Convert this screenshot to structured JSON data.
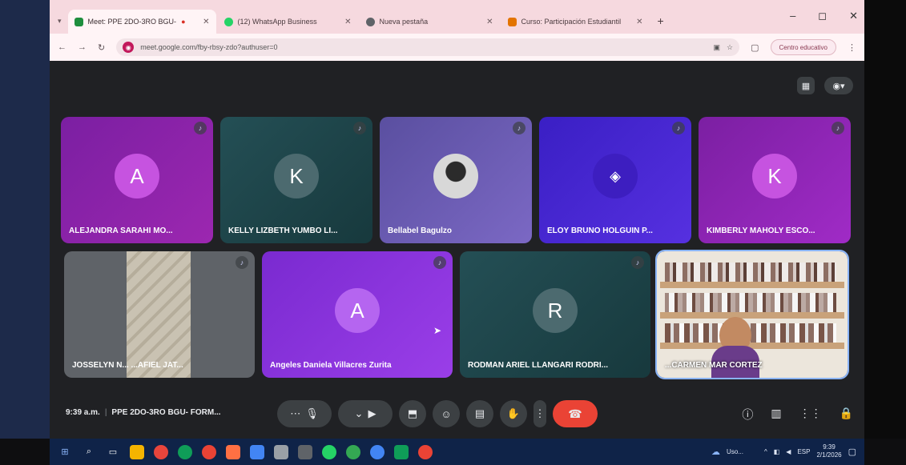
{
  "browser": {
    "tabs": [
      {
        "label": "Meet: PPE 2DO-3RO BGU-",
        "color": "#1e8e3e",
        "active": true
      },
      {
        "label": "(12) WhatsApp Business",
        "color": "#25d366",
        "active": false
      },
      {
        "label": "Nueva pestaña",
        "color": "#5f6368",
        "active": false
      },
      {
        "label": "Curso: Participación Estudiantil",
        "color": "#e37400",
        "active": false
      }
    ],
    "new_tab": "+",
    "window_controls": {
      "minimize": "–",
      "maximize": "◻",
      "close": "✕"
    },
    "url": "meet.google.com/fby-rbsy-zdo?authuser=0",
    "profile_label": "Centro educativo"
  },
  "meet": {
    "participants": [
      {
        "name": "ALEJANDRA SARAHI MO...",
        "initial": "A",
        "bg": "#8e24aa",
        "avatar_bg": "#c653e0"
      },
      {
        "name": "KELLY LIZBETH YUMBO LI...",
        "initial": "K",
        "bg": "#1f4b4f",
        "avatar_bg": "#4c6a6f"
      },
      {
        "name": "Bellabel Bagulzo",
        "initial": "",
        "bg": "#6a5aa8",
        "avatar_bg": "#d0d0d0"
      },
      {
        "name": "ELOY BRUNO HOLGUIN P...",
        "initial": "",
        "bg": "#4a2ad0",
        "avatar_bg": "#3d1ec0"
      },
      {
        "name": "KIMBERLY MAHOLY ESCO...",
        "initial": "K",
        "bg": "#8a1fb0",
        "avatar_bg": "#c653e0"
      },
      {
        "name": "JOSSELYN N... ...AFIEL JAT...",
        "initial": "",
        "bg": "#5f6368",
        "avatar_bg": "#a89f8e"
      },
      {
        "name": "Angeles Daniela Villacres Zurita",
        "initial": "A",
        "bg": "#8a2ad6",
        "avatar_bg": "#b565f0"
      },
      {
        "name": "RODMAN ARIEL LLANGARI RODRI...",
        "initial": "R",
        "bg": "#1f4b4f",
        "avatar_bg": "#4c6a6f"
      },
      {
        "name": "...CARMEN MAR CORTEZ",
        "initial": "",
        "bg": "#e9e4dc",
        "avatar_bg": "#b37a4f"
      }
    ],
    "time": "9:39 a.m.",
    "meeting_name": "PPE 2DO-3RO BGU- FORM...",
    "controls": {
      "more_mic": "⋯",
      "mic": "🎙",
      "more_cam": "⌄",
      "camera": "▶",
      "present": "⬒",
      "emoji": "☺",
      "captions": "▤",
      "raise_hand": "✋",
      "more": "⋮",
      "end_call": "☎"
    },
    "right_controls": {
      "info": "ⓘ",
      "chat": "▥",
      "activities": "⋮⋮",
      "lock": "🔒"
    }
  },
  "taskbar": {
    "weather": "Uso...",
    "language": "ESP",
    "time": "9:39",
    "date": "2/1/2026"
  },
  "colors": {
    "accent_end": "#ea4335",
    "meet_bg": "#202124",
    "tab_bar": "#f6d9df"
  }
}
